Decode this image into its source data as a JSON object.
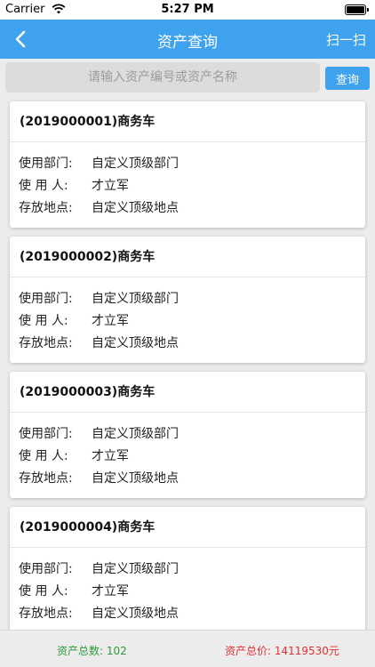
{
  "status_bar": {
    "carrier": "Carrier",
    "time": "5:27 PM"
  },
  "nav": {
    "title": "资产查询",
    "scan_label": "扫一扫"
  },
  "search": {
    "placeholder": "请输入资产编号或资产名称",
    "value": "",
    "button_label": "查询"
  },
  "field_labels": {
    "department": "使用部门:",
    "user": "使 用 人:",
    "location": "存放地点:"
  },
  "assets": [
    {
      "title": "(2019000001)商务车",
      "department": "自定义顶级部门",
      "user": "才立军",
      "location": "自定义顶级地点"
    },
    {
      "title": "(2019000002)商务车",
      "department": "自定义顶级部门",
      "user": "才立军",
      "location": "自定义顶级地点"
    },
    {
      "title": "(2019000003)商务车",
      "department": "自定义顶级部门",
      "user": "才立军",
      "location": "自定义顶级地点"
    },
    {
      "title": "(2019000004)商务车",
      "department": "自定义顶级部门",
      "user": "才立军",
      "location": "自定义顶级地点"
    }
  ],
  "footer": {
    "total_count": "资产总数:  102",
    "total_price": "资产总价:  14119530元"
  },
  "colors": {
    "accent": "#3fa2ee",
    "count_green": "#2e9a3a",
    "price_red": "#e03030"
  },
  "icons": {
    "back": "chevron-left-icon",
    "wifi": "wifi-icon",
    "battery": "battery-icon"
  }
}
